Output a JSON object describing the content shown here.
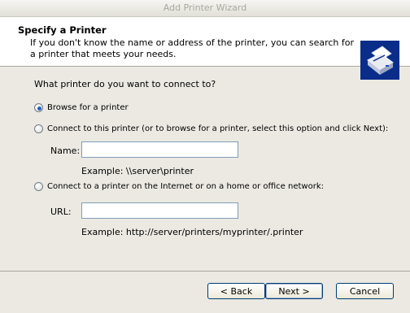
{
  "window": {
    "title": "Add Printer Wizard"
  },
  "header": {
    "title": "Specify a Printer",
    "description": "If you don't know the name or address of the printer, you can search for a printer that meets your needs."
  },
  "main": {
    "question": "What printer do you want to connect to?",
    "options": [
      {
        "label": "Browse for a printer",
        "checked": true
      },
      {
        "label": "Connect to this printer (or to browse for a printer, select this option and click Next):",
        "checked": false
      },
      {
        "label": "Connect to a printer on the Internet or on a home or office network:",
        "checked": false
      }
    ],
    "name_field": {
      "label": "Name:",
      "value": "",
      "example": "Example: \\\\server\\printer"
    },
    "url_field": {
      "label": "URL:",
      "value": "",
      "example": "Example: http://server/printers/myprinter/.printer"
    }
  },
  "footer": {
    "back_label": "< Back",
    "next_label": "Next >",
    "cancel_label": "Cancel"
  }
}
